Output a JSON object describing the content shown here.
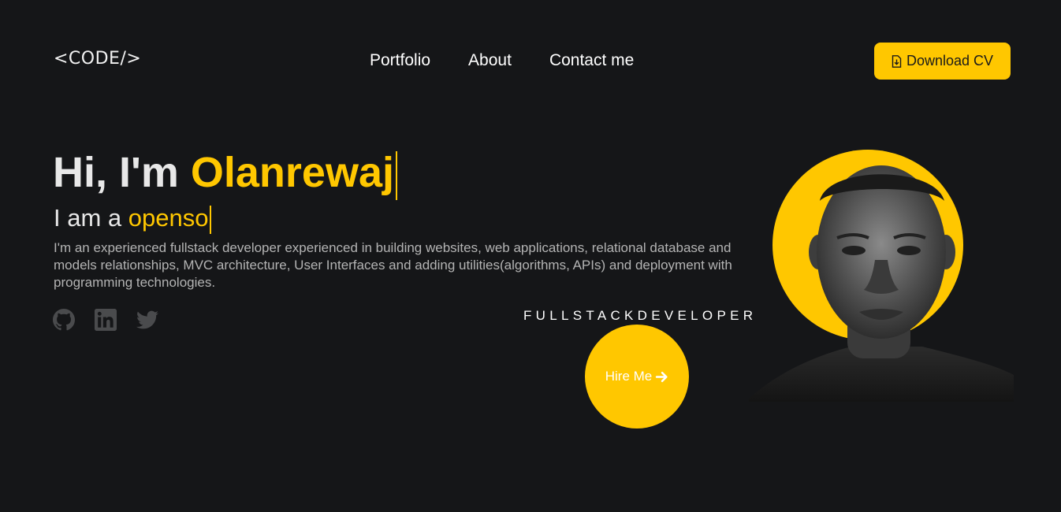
{
  "header": {
    "logo": "<CODE/>",
    "nav": [
      "Portfolio",
      "About",
      "Contact me"
    ],
    "cv_button": "Download CV",
    "cv_icon": "file-download-icon"
  },
  "hero": {
    "greeting": "Hi, I'm ",
    "name": "Olanrewaj",
    "role_prefix": "I am a ",
    "role_typed": "openso",
    "bio": "I'm an experienced fullstack developer experienced in building websites, web applications, relational database and models relationships, MVC architecture, User Interfaces and adding utilities(algorithms, APIs) and deployment with programming technologies.",
    "socials": [
      "github-icon",
      "linkedin-icon",
      "twitter-icon"
    ],
    "tagline": "FULLSTACKDEVELOPER",
    "hire_button": "Hire Me",
    "hire_icon": "arrow-right-icon"
  },
  "colors": {
    "background": "#151618",
    "accent": "#ffc700",
    "text": "#e8e8e8",
    "muted": "#b4b4b4"
  }
}
